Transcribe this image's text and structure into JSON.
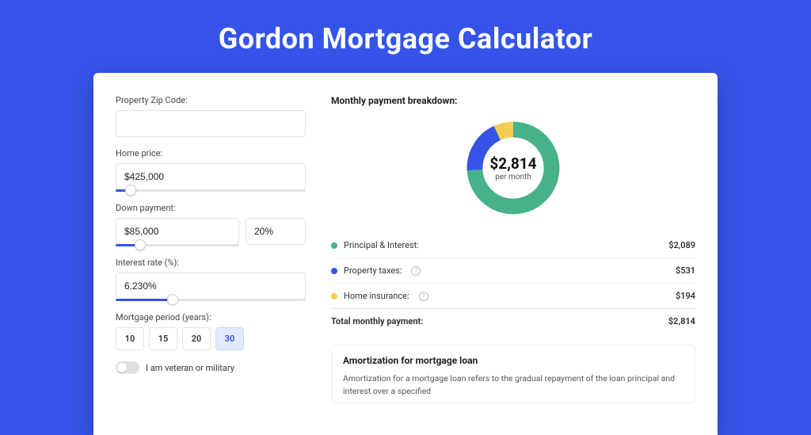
{
  "title": "Gordon Mortgage Calculator",
  "left": {
    "zip": {
      "label": "Property Zip Code:",
      "value": ""
    },
    "price": {
      "label": "Home price:",
      "value": "$425,000",
      "slider_pct": 8
    },
    "down": {
      "label": "Down payment:",
      "amount": "$85,000",
      "pct": "20%",
      "slider_pct": 20
    },
    "rate": {
      "label": "Interest rate (%):",
      "value": "6.230%",
      "slider_pct": 30
    },
    "period": {
      "label": "Mortgage period (years):",
      "options": [
        "10",
        "15",
        "20",
        "30"
      ],
      "selected": "30"
    },
    "veteran_label": "I am veteran or military"
  },
  "right": {
    "breakdown_title": "Monthly payment breakdown:",
    "donut_amount": "$2,814",
    "donut_sub": "per month",
    "items": [
      {
        "label": "Principal & Interest:",
        "value": "$2,089",
        "color": "#47B28A",
        "pct": 74,
        "info": false
      },
      {
        "label": "Property taxes:",
        "value": "$531",
        "color": "#3553E8",
        "pct": 19,
        "info": true
      },
      {
        "label": "Home insurance:",
        "value": "$194",
        "color": "#F3CE55",
        "pct": 7,
        "info": true
      }
    ],
    "total_label": "Total monthly payment:",
    "total_value": "$2,814",
    "amort_title": "Amortization for mortgage loan",
    "amort_text": "Amortization for a mortgage loan refers to the gradual repayment of the loan principal and interest over a specified"
  },
  "chart_data": {
    "type": "pie",
    "title": "Monthly payment breakdown",
    "categories": [
      "Principal & Interest",
      "Property taxes",
      "Home insurance"
    ],
    "values": [
      2089,
      531,
      194
    ],
    "total": 2814,
    "unit": "$ per month"
  }
}
